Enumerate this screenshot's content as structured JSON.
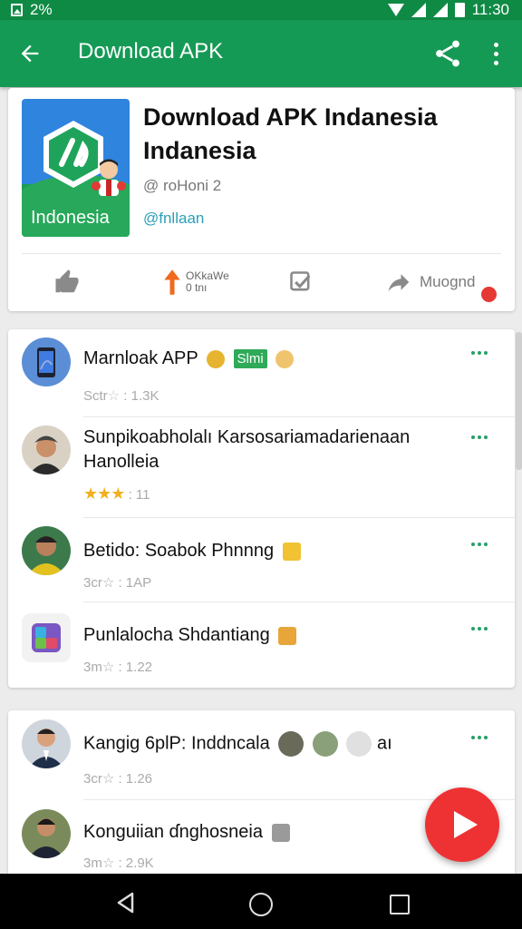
{
  "status_bar": {
    "battery_text": "2%",
    "time": "11:30"
  },
  "app_bar": {
    "title": "Download APK"
  },
  "app_card": {
    "icon_label": "Indonesia",
    "name_line1": "Download APK Indanesia",
    "name_line2": "Indanesia",
    "developer": "@ roHoni 2",
    "handle": "@fnllaan",
    "actions": [
      {
        "icon": "thumbs-up-icon",
        "label": ""
      },
      {
        "icon": "arrow-up-icon",
        "label_line1": "OKkaWe",
        "label_line2": "0 tnı"
      },
      {
        "icon": "checkbox-icon",
        "label": ""
      },
      {
        "icon": "forward-icon",
        "label": "Muognd"
      }
    ],
    "badge_color": "#e53935"
  },
  "list1": [
    {
      "title": "Marnloak APP",
      "tag": "Slmi",
      "meta_stars": "Sctr",
      "meta_value": ": 1.3K"
    },
    {
      "title_line1": "Sunpikoabholalı Karsosariamadarienaan",
      "title_line2": "Hanolleia",
      "meta_stars": "★★★",
      "meta_value": ": 11"
    },
    {
      "title": "Betido: Soabok Phnnng",
      "meta_stars": "3cr☆",
      "meta_value": ": 1AP"
    },
    {
      "title": "Punlalocha Shdantiang",
      "meta_stars": "3m☆",
      "meta_value": ": 1.22"
    }
  ],
  "list2": [
    {
      "title": "Kangig 6plP: Inddncala",
      "suffix": "aı",
      "meta_stars": "3cr☆",
      "meta_value": ": 1.26"
    },
    {
      "title": "Konguiian ɗnghosneia",
      "meta_stars": "3m☆",
      "meta_value": ": 2.9K"
    }
  ],
  "colors": {
    "primary": "#159a55",
    "status": "#0f8a45",
    "accent": "#27a06a",
    "fab": "#ee3234",
    "link": "#2a9fb8"
  }
}
